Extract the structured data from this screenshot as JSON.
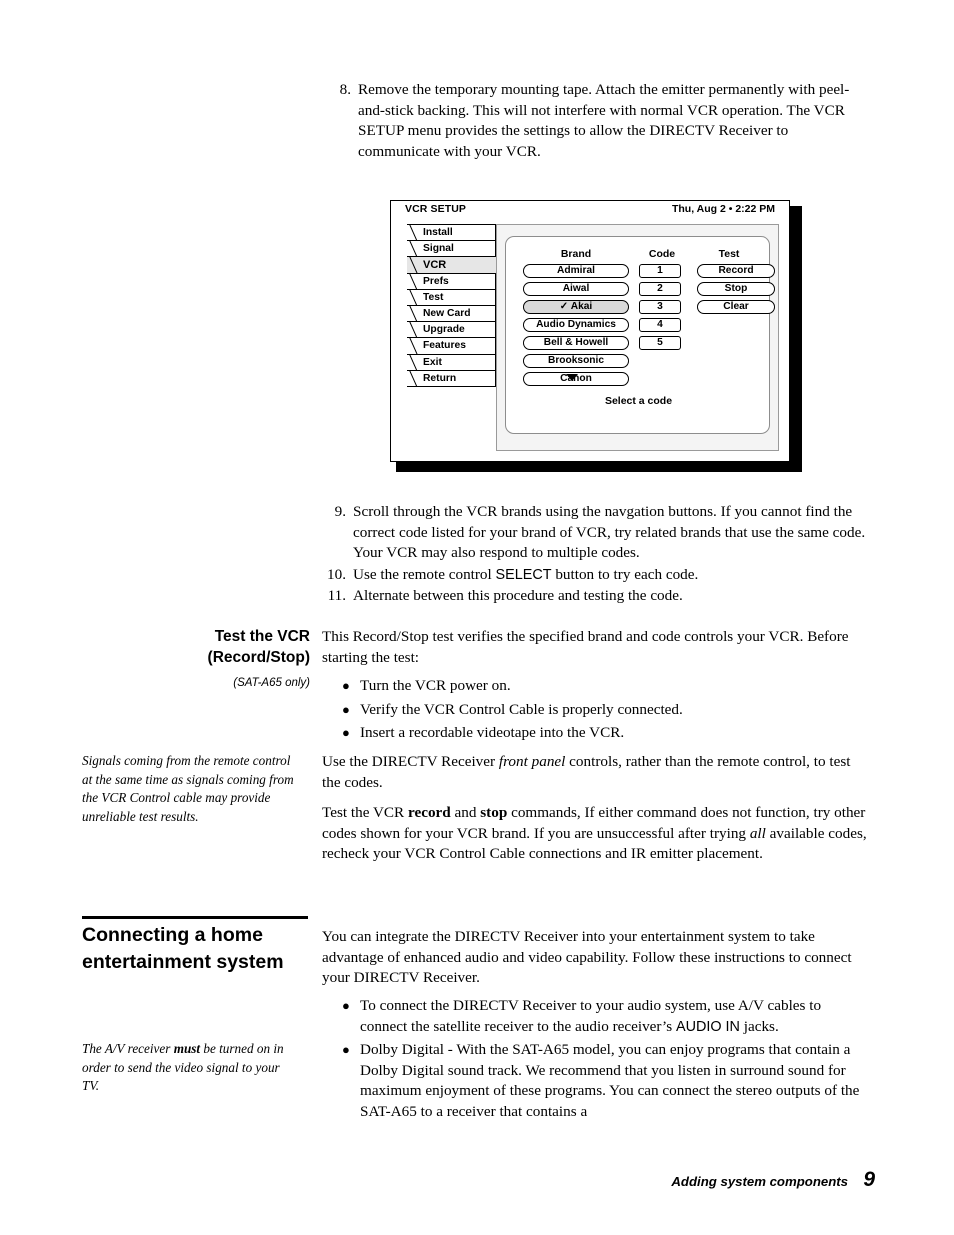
{
  "steps_top": [
    {
      "num": "8.",
      "text": "Remove the temporary mounting tape. Attach the emitter permanently with peel-and-stick backing. This will not interfere with normal VCR operation. The VCR SETUP menu provides the settings to allow the DIRECTV Receiver to communicate with your VCR."
    }
  ],
  "vcr_screen": {
    "title": "VCR SETUP",
    "clock": "Thu, Aug 2  •  2:22 PM",
    "tabs": [
      {
        "label": "Install",
        "selected": false
      },
      {
        "label": "Signal",
        "selected": false
      },
      {
        "label": "VCR",
        "selected": true
      },
      {
        "label": "Prefs",
        "selected": false
      },
      {
        "label": "Test",
        "selected": false
      },
      {
        "label": "New Card",
        "selected": false
      },
      {
        "label": "Upgrade",
        "selected": false
      },
      {
        "label": "Features",
        "selected": false
      },
      {
        "label": "Exit",
        "selected": false
      },
      {
        "label": "Return",
        "selected": false
      }
    ],
    "column_headers": {
      "brand": "Brand",
      "code": "Code",
      "test": "Test"
    },
    "brands": [
      {
        "label": "Admiral",
        "selected": false
      },
      {
        "label": "Aiwal",
        "selected": false
      },
      {
        "label": "✓ Akai",
        "selected": true
      },
      {
        "label": "Audio Dynamics",
        "selected": false
      },
      {
        "label": "Bell & Howell",
        "selected": false
      },
      {
        "label": "Brooksonic",
        "selected": false
      },
      {
        "label": "Canon",
        "selected": false
      }
    ],
    "codes": [
      "1",
      "2",
      "3",
      "4",
      "5"
    ],
    "tests": [
      "Record",
      "Stop",
      "Clear"
    ],
    "footer_hint": "Select a code",
    "scroll_indicator": "down-arrow"
  },
  "steps_bottom": [
    {
      "num": "9.",
      "text": "Scroll through the VCR brands using the navgation buttons. If you cannot find the correct code listed for your brand of VCR, try related brands that use the same code. Your VCR may also respond to multiple codes."
    },
    {
      "num": "10.",
      "text_pre": "Use the remote control ",
      "text_key": "SELECT",
      "text_post": " button to try each code."
    },
    {
      "num": "11.",
      "text": "Alternate between this procedure and testing the code."
    }
  ],
  "section_test_vcr": {
    "heading_line1": "Test the VCR",
    "heading_line2": "(Record/Stop)",
    "subheading": "(SAT-A65 only)",
    "intro": "This Record/Stop test verifies the specified brand and code controls your VCR. Before starting the test:",
    "bullets": [
      "Turn the VCR power on.",
      "Verify the VCR Control Cable is properly connected.",
      "Insert a recordable videotape into the VCR."
    ],
    "margin_note": "Signals coming from the remote control at the same time as signals coming from the VCR Control cable may provide unreliable test results.",
    "para_front_panel_pre": "Use the DIRECTV Receiver ",
    "para_front_panel_em": "front panel",
    "para_front_panel_post": " controls, rather than the remote control, to test the codes.",
    "para_test_p1": "Test the VCR ",
    "para_test_b1": "record",
    "para_test_p2": " and ",
    "para_test_b2": "stop",
    "para_test_p3": " commands, If either command does not function, try other codes shown for your VCR brand. If you are unsuccessful after trying ",
    "para_test_i1": "all",
    "para_test_p4": " available codes, recheck your VCR Control Cable connections and IR emitter placement."
  },
  "section_home_entertainment": {
    "heading": "Connecting a home entertainment system",
    "margin_note_pre": "The A/V receiver ",
    "margin_note_bold": "must",
    "margin_note_post": " be turned on in order to send the video signal to your TV.",
    "intro": "You can integrate the DIRECTV Receiver into your entertainment system to take advantage of enhanced audio and video capability. Follow these instructions to connect your DIRECTV Receiver.",
    "bullet1_pre": "To connect the DIRECTV Receiver to your audio system, use A/V cables to connect the satellite receiver to the audio receiver’s ",
    "bullet1_key": "AUDIO IN",
    "bullet1_post": " jacks.",
    "bullet2": "Dolby Digital - With the SAT-A65 model, you can enjoy programs that contain a Dolby Digital sound track. We recommend that you listen in surround sound for maximum enjoyment of these programs. You can connect the stereo outputs of the SAT-A65 to a receiver that contains a"
  },
  "footer": {
    "chapter": "Adding system components",
    "page_number": "9"
  }
}
